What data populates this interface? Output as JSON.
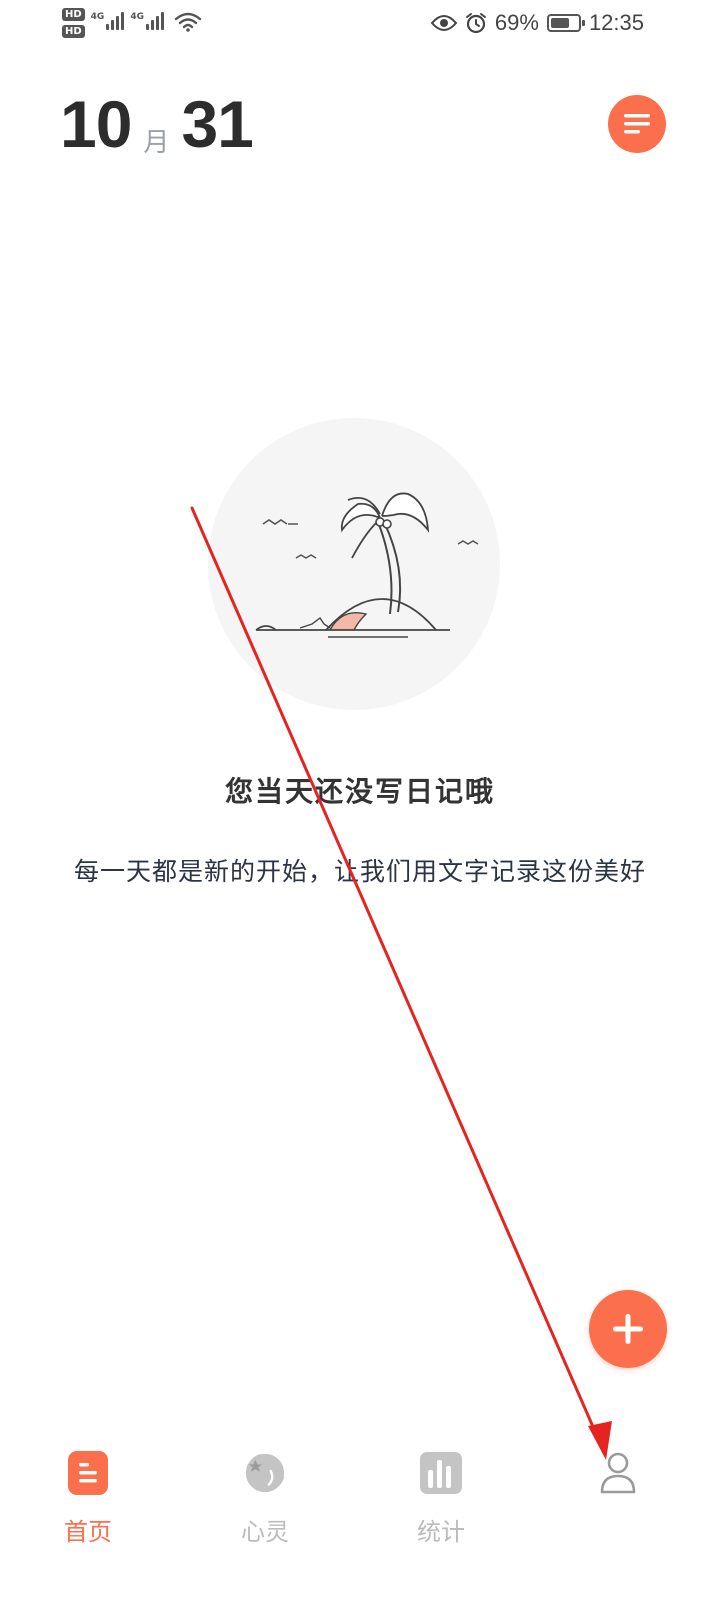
{
  "status_bar": {
    "hd_labels": [
      "HD",
      "HD"
    ],
    "network_labels": [
      "4G",
      "4G"
    ],
    "battery_percent": "69%",
    "battery_level": 0.69,
    "time": "12:35",
    "icons": [
      "wifi-icon",
      "eye-icon",
      "alarm-icon",
      "battery-icon"
    ]
  },
  "header": {
    "month": "10",
    "month_unit": "月",
    "day": "31",
    "menu_icon": "list-icon"
  },
  "empty_state": {
    "illustration": "island-palm-icon",
    "title": "您当天还没写日记哦",
    "subtitle": "每一天都是新的开始，让我们用文字记录这份美好"
  },
  "fab": {
    "icon": "plus-icon"
  },
  "bottom_nav": {
    "items": [
      {
        "label": "首页",
        "icon": "home-doc-icon",
        "active": true
      },
      {
        "label": "心灵",
        "icon": "moon-star-icon",
        "active": false
      },
      {
        "label": "统计",
        "icon": "bar-chart-icon",
        "active": false
      },
      {
        "label": "",
        "icon": "profile-icon",
        "active": false
      }
    ]
  },
  "colors": {
    "accent": "#fb6f4c",
    "text_dark": "#2d2d2d",
    "text_muted": "#9aa0aa",
    "nav_inactive": "#bbbbbb",
    "annotation": "#e52421"
  }
}
